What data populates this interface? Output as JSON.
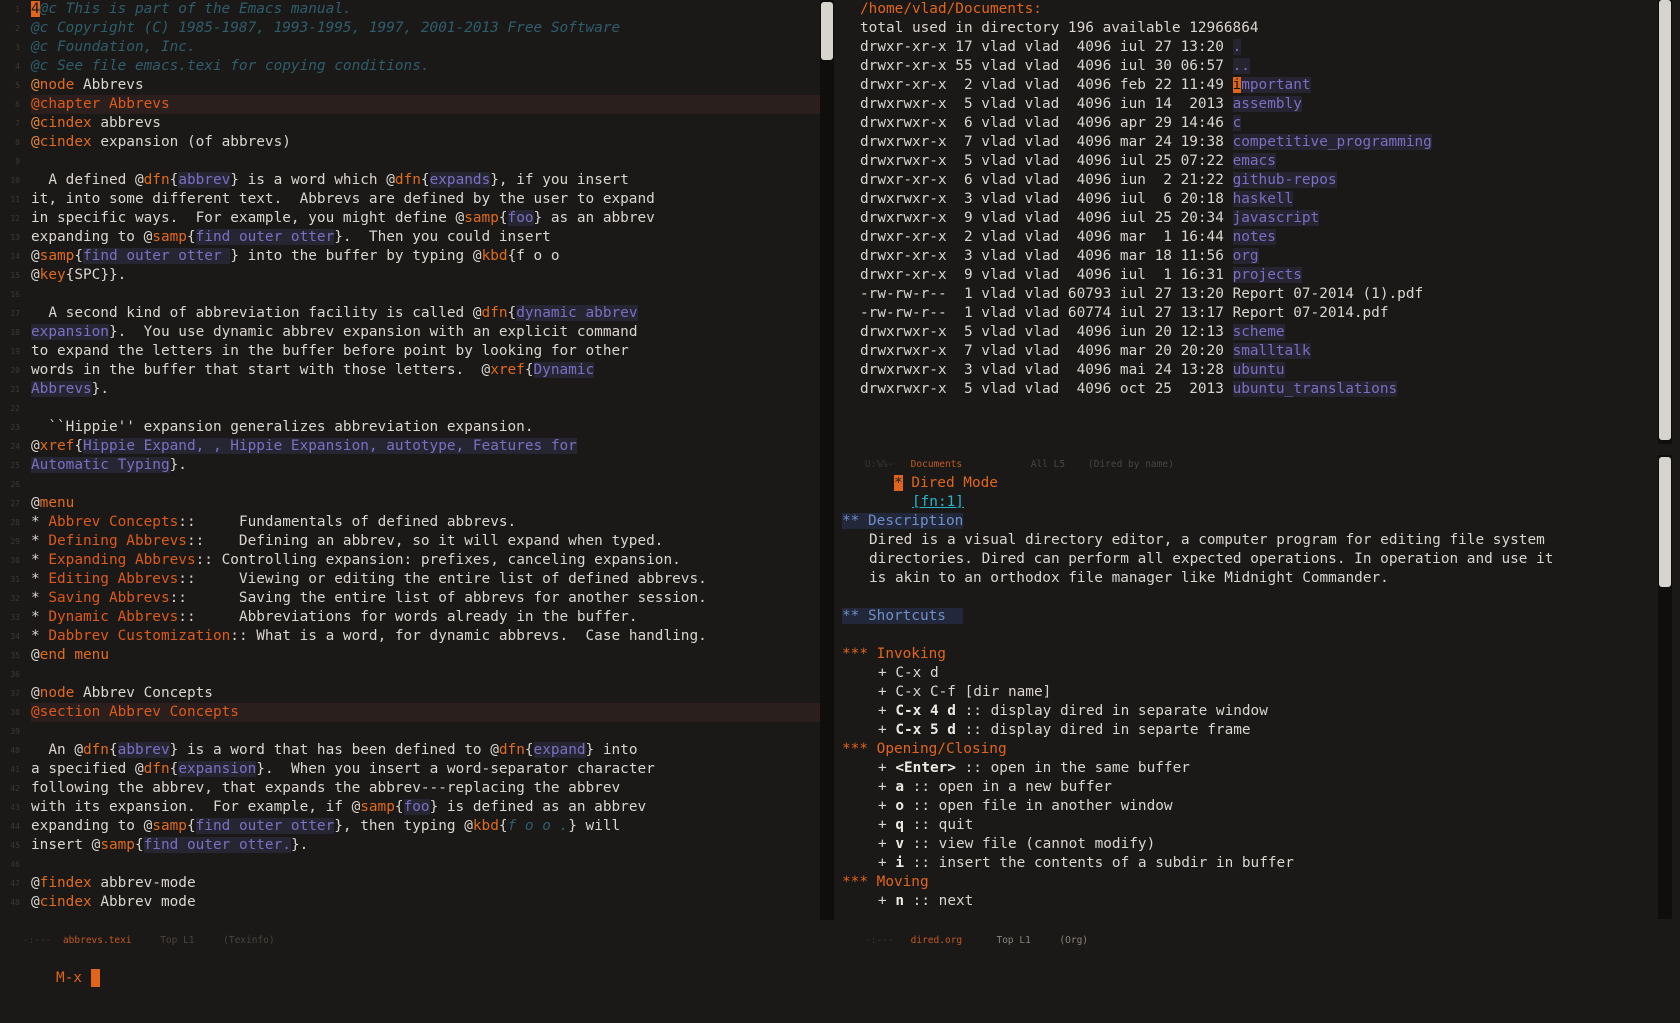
{
  "left_window": {
    "lines": [
      [
        {
          "t": "4",
          "c": "cursor"
        },
        {
          "t": "@c This is part of the Emacs manual.",
          "c": "cmt"
        }
      ],
      [
        {
          "t": "@c Copyright (C) 1985-1987, 1993-1995, 1997, 2001-2013 Free Software",
          "c": "cmt"
        }
      ],
      [
        {
          "t": "@c Foundation, Inc.",
          "c": "cmt"
        }
      ],
      [
        {
          "t": "@c See file emacs.texi for copying conditions.",
          "c": "cmt"
        }
      ],
      [
        {
          "t": "@",
          "c": "at"
        },
        {
          "t": "node",
          "c": "kw"
        },
        {
          "t": " Abbrevs"
        }
      ],
      [
        {
          "t": "@chapter Abbrevs",
          "c": "chap"
        }
      ],
      [
        {
          "t": "@",
          "c": "at"
        },
        {
          "t": "cindex",
          "c": "kw"
        },
        {
          "t": " abbrevs"
        }
      ],
      [
        {
          "t": "@",
          "c": "at"
        },
        {
          "t": "cindex",
          "c": "kw"
        },
        {
          "t": " expansion (of abbrevs)"
        }
      ],
      [],
      [
        {
          "t": "  A defined @"
        },
        {
          "t": "dfn",
          "c": "kw"
        },
        {
          "t": "{"
        },
        {
          "t": "abbrev",
          "c": "arg"
        },
        {
          "t": "} is a word which @"
        },
        {
          "t": "dfn",
          "c": "kw"
        },
        {
          "t": "{"
        },
        {
          "t": "expands",
          "c": "arg"
        },
        {
          "t": "}, if you insert"
        }
      ],
      [
        {
          "t": "it, into some different text.  Abbrevs are defined by the user to expand"
        }
      ],
      [
        {
          "t": "in specific ways.  For example, you might define @"
        },
        {
          "t": "samp",
          "c": "kw"
        },
        {
          "t": "{"
        },
        {
          "t": "foo",
          "c": "arg"
        },
        {
          "t": "} as an abbrev"
        }
      ],
      [
        {
          "t": "expanding to @"
        },
        {
          "t": "samp",
          "c": "kw"
        },
        {
          "t": "{"
        },
        {
          "t": "find outer otter",
          "c": "arg"
        },
        {
          "t": "}.  Then you could insert"
        }
      ],
      [
        {
          "t": "@"
        },
        {
          "t": "samp",
          "c": "kw"
        },
        {
          "t": "{"
        },
        {
          "t": "find outer otter ",
          "c": "arg"
        },
        {
          "t": "} into the buffer by typing @"
        },
        {
          "t": "kbd",
          "c": "kw"
        },
        {
          "t": "{f o o"
        }
      ],
      [
        {
          "t": "@"
        },
        {
          "t": "key",
          "c": "kw"
        },
        {
          "t": "{SPC}}."
        }
      ],
      [],
      [
        {
          "t": "  A second kind of abbreviation facility is called @"
        },
        {
          "t": "dfn",
          "c": "kw"
        },
        {
          "t": "{"
        },
        {
          "t": "dynamic abbrev",
          "c": "arg"
        }
      ],
      [
        {
          "t": "expansion",
          "c": "arg"
        },
        {
          "t": "}.  You use dynamic abbrev expansion with an explicit command"
        }
      ],
      [
        {
          "t": "to expand the letters in the buffer before point by looking for other"
        }
      ],
      [
        {
          "t": "words in the buffer that start with those letters.  @"
        },
        {
          "t": "xref",
          "c": "kw"
        },
        {
          "t": "{"
        },
        {
          "t": "Dynamic",
          "c": "arg"
        }
      ],
      [
        {
          "t": "Abbrevs",
          "c": "arg"
        },
        {
          "t": "}."
        }
      ],
      [],
      [
        {
          "t": "  ``Hippie'' expansion generalizes abbreviation expansion."
        }
      ],
      [
        {
          "t": "@"
        },
        {
          "t": "xref",
          "c": "kw"
        },
        {
          "t": "{"
        },
        {
          "t": "Hippie Expand, , Hippie Expansion, autotype, Features for",
          "c": "arg"
        }
      ],
      [
        {
          "t": "Automatic Typing",
          "c": "arg"
        },
        {
          "t": "}."
        }
      ],
      [],
      [
        {
          "t": "@"
        },
        {
          "t": "menu",
          "c": "kw"
        }
      ],
      [
        {
          "t": "* "
        },
        {
          "t": "Abbrev Concepts",
          "c": "chap"
        },
        {
          "t": "::     Fundamentals of defined abbrevs."
        }
      ],
      [
        {
          "t": "* "
        },
        {
          "t": "Defining Abbrevs",
          "c": "chap"
        },
        {
          "t": "::    Defining an abbrev, so it will expand when typed."
        }
      ],
      [
        {
          "t": "* "
        },
        {
          "t": "Expanding Abbrevs",
          "c": "chap"
        },
        {
          "t": ":: Controlling expansion: prefixes, canceling expansion."
        }
      ],
      [
        {
          "t": "* "
        },
        {
          "t": "Editing Abbrevs",
          "c": "chap"
        },
        {
          "t": "::     Viewing or editing the entire list of defined abbrevs."
        }
      ],
      [
        {
          "t": "* "
        },
        {
          "t": "Saving Abbrevs",
          "c": "chap"
        },
        {
          "t": "::      Saving the entire list of abbrevs for another session."
        }
      ],
      [
        {
          "t": "* "
        },
        {
          "t": "Dynamic Abbrevs",
          "c": "chap"
        },
        {
          "t": "::     Abbreviations for words already in the buffer."
        }
      ],
      [
        {
          "t": "* "
        },
        {
          "t": "Dabbrev Customization",
          "c": "chap"
        },
        {
          "t": ":: What is a word, for dynamic abbrevs.  Case handling."
        }
      ],
      [
        {
          "t": "@"
        },
        {
          "t": "end menu",
          "c": "kw"
        }
      ],
      [],
      [
        {
          "t": "@"
        },
        {
          "t": "node",
          "c": "kw"
        },
        {
          "t": " Abbrev Concepts"
        }
      ],
      [
        {
          "t": "@section Abbrev Concepts",
          "c": "chap"
        }
      ],
      [],
      [
        {
          "t": "  An @"
        },
        {
          "t": "dfn",
          "c": "kw"
        },
        {
          "t": "{"
        },
        {
          "t": "abbrev",
          "c": "arg"
        },
        {
          "t": "} is a word that has been defined to @"
        },
        {
          "t": "dfn",
          "c": "kw"
        },
        {
          "t": "{"
        },
        {
          "t": "expand",
          "c": "arg"
        },
        {
          "t": "} into"
        }
      ],
      [
        {
          "t": "a specified @"
        },
        {
          "t": "dfn",
          "c": "kw"
        },
        {
          "t": "{"
        },
        {
          "t": "expansion",
          "c": "arg"
        },
        {
          "t": "}.  When you insert a word-separator character"
        }
      ],
      [
        {
          "t": "following the abbrev, that expands the abbrev---replacing the abbrev"
        }
      ],
      [
        {
          "t": "with its expansion.  For example, if @"
        },
        {
          "t": "samp",
          "c": "kw"
        },
        {
          "t": "{"
        },
        {
          "t": "foo",
          "c": "arg"
        },
        {
          "t": "} is defined as an abbrev"
        }
      ],
      [
        {
          "t": "expanding to @"
        },
        {
          "t": "samp",
          "c": "kw"
        },
        {
          "t": "{"
        },
        {
          "t": "find outer otter",
          "c": "arg"
        },
        {
          "t": "}, then typing @"
        },
        {
          "t": "kbd",
          "c": "kw"
        },
        {
          "t": "{"
        },
        {
          "t": "f o o .",
          "c": "cmt"
        },
        {
          "t": "} will"
        }
      ],
      [
        {
          "t": "insert @"
        },
        {
          "t": "samp",
          "c": "kw"
        },
        {
          "t": "{"
        },
        {
          "t": "find outer otter.",
          "c": "arg"
        },
        {
          "t": "}."
        }
      ],
      [],
      [
        {
          "t": "@"
        },
        {
          "t": "findex",
          "c": "kw"
        },
        {
          "t": " abbrev-mode"
        }
      ],
      [
        {
          "t": "@"
        },
        {
          "t": "cindex",
          "c": "kw"
        },
        {
          "t": " Abbrev mode"
        }
      ]
    ],
    "modeline": {
      "buffer": "abbrevs.texi",
      "pos": "Top L1",
      "mode": "(Texinfo)"
    }
  },
  "dired": {
    "header": "/home/vlad/Documents:",
    "total": "total used in directory 196 available 12966864",
    "rows": [
      {
        "perm": "drwxr-xr-x",
        "n": "17",
        "u": "vlad",
        "g": "vlad",
        "size": "4096",
        "date": "iul 27 13:20",
        "name": ".",
        "dir": true
      },
      {
        "perm": "drwxr-xr-x",
        "n": "55",
        "u": "vlad",
        "g": "vlad",
        "size": "4096",
        "date": "iul 30 06:57",
        "name": "..",
        "dir": true
      },
      {
        "perm": "drwxr-xr-x",
        "n": " 2",
        "u": "vlad",
        "g": "vlad",
        "size": "4096",
        "date": "feb 22 11:49",
        "name": "important",
        "dir": true
      },
      {
        "perm": "drwxrwxr-x",
        "n": " 5",
        "u": "vlad",
        "g": "vlad",
        "size": "4096",
        "date": "iun 14  2013",
        "name": "assembly",
        "dir": true
      },
      {
        "perm": "drwxrwxr-x",
        "n": " 6",
        "u": "vlad",
        "g": "vlad",
        "size": "4096",
        "date": "apr 29 14:46",
        "name": "c",
        "dir": true
      },
      {
        "perm": "drwxrwxr-x",
        "n": " 7",
        "u": "vlad",
        "g": "vlad",
        "size": "4096",
        "date": "mar 24 19:38",
        "name": "competitive_programming",
        "dir": true
      },
      {
        "perm": "drwxrwxr-x",
        "n": " 5",
        "u": "vlad",
        "g": "vlad",
        "size": "4096",
        "date": "iul 25 07:22",
        "name": "emacs",
        "dir": true
      },
      {
        "perm": "drwxr-xr-x",
        "n": " 6",
        "u": "vlad",
        "g": "vlad",
        "size": "4096",
        "date": "iun  2 21:22",
        "name": "github-repos",
        "dir": true
      },
      {
        "perm": "drwxrwxr-x",
        "n": " 3",
        "u": "vlad",
        "g": "vlad",
        "size": "4096",
        "date": "iul  6 20:18",
        "name": "haskell",
        "dir": true
      },
      {
        "perm": "drwxrwxr-x",
        "n": " 9",
        "u": "vlad",
        "g": "vlad",
        "size": "4096",
        "date": "iul 25 20:34",
        "name": "javascript",
        "dir": true
      },
      {
        "perm": "drwxr-xr-x",
        "n": " 2",
        "u": "vlad",
        "g": "vlad",
        "size": "4096",
        "date": "mar  1 16:44",
        "name": "notes",
        "dir": true
      },
      {
        "perm": "drwxr-xr-x",
        "n": " 3",
        "u": "vlad",
        "g": "vlad",
        "size": "4096",
        "date": "mar 18 11:56",
        "name": "org",
        "dir": true
      },
      {
        "perm": "drwxr-xr-x",
        "n": " 9",
        "u": "vlad",
        "g": "vlad",
        "size": "4096",
        "date": "iul  1 16:31",
        "name": "projects",
        "dir": true
      },
      {
        "perm": "-rw-rw-r--",
        "n": " 1",
        "u": "vlad",
        "g": "vlad",
        "size": "60793",
        "date": "iul 27 13:20",
        "name": "Report 07-2014 (1).pdf",
        "dir": false
      },
      {
        "perm": "-rw-rw-r--",
        "n": " 1",
        "u": "vlad",
        "g": "vlad",
        "size": "60774",
        "date": "iul 27 13:17",
        "name": "Report 07-2014.pdf",
        "dir": false
      },
      {
        "perm": "drwxrwxr-x",
        "n": " 5",
        "u": "vlad",
        "g": "vlad",
        "size": "4096",
        "date": "iun 20 12:13",
        "name": "scheme",
        "dir": true
      },
      {
        "perm": "drwxrwxr-x",
        "n": " 7",
        "u": "vlad",
        "g": "vlad",
        "size": "4096",
        "date": "mar 20 20:20",
        "name": "smalltalk",
        "dir": true
      },
      {
        "perm": "drwxrwxr-x",
        "n": " 3",
        "u": "vlad",
        "g": "vlad",
        "size": "4096",
        "date": "mai 24 13:28",
        "name": "ubuntu",
        "dir": true
      },
      {
        "perm": "drwxrwxr-x",
        "n": " 5",
        "u": "vlad",
        "g": "vlad",
        "size": "4096",
        "date": "oct 25  2013",
        "name": "ubuntu_translations",
        "dir": true
      }
    ],
    "modeline": {
      "status": "U:%%-",
      "buffer": "Documents",
      "pos": "All L5",
      "mode": "(Dired by name)"
    }
  },
  "org": {
    "title": "* Dired Mode",
    "fn": "[fn:1]",
    "desc_head": "** Description",
    "desc": [
      "Dired is a visual directory editor, a computer program for editing file system",
      "directories. Dired can perform all expected operations. In operation and use it",
      "is akin to an orthodox file manager like Midnight Commander."
    ],
    "shortcuts_head": "** Shortcuts",
    "invoking_head": "*** Invoking",
    "invoking": [
      {
        "b": "",
        "t": "+ C-x d"
      },
      {
        "b": "",
        "t": "+ C-x C-f [dir name]"
      },
      {
        "b": "C-x 4 d",
        "t": " :: display dired in separate window"
      },
      {
        "b": "C-x 5 d",
        "t": " :: display dired in separte frame"
      }
    ],
    "opening_head": "*** Opening/Closing",
    "opening": [
      {
        "b": "<Enter>",
        "t": " :: open in the same buffer"
      },
      {
        "b": "a",
        "t": " :: open in a new buffer"
      },
      {
        "b": "o",
        "t": " :: open file in another window"
      },
      {
        "b": "q",
        "t": " :: quit"
      },
      {
        "b": "v",
        "t": " :: view file (cannot modify)"
      },
      {
        "b": "i",
        "t": " :: insert the contents of a subdir in buffer"
      }
    ],
    "moving_head": "*** Moving",
    "moving": [
      {
        "b": "n",
        "t": " :: next"
      }
    ],
    "modeline": {
      "status": "-:---",
      "buffer": "dired.org",
      "pos": "Top L1",
      "mode": "(Org)"
    }
  },
  "minibuffer": {
    "prompt": "M-x"
  },
  "colors": {
    "bg": "#1b1918",
    "fg": "#d9d5cf",
    "accent": "#e0651a",
    "link": "#7a6fc2"
  }
}
